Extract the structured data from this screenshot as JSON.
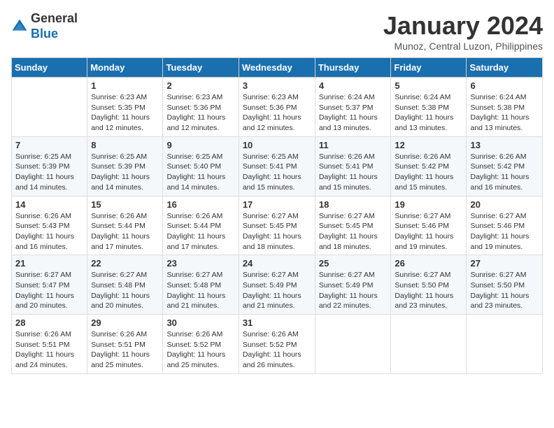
{
  "header": {
    "logo_line1": "General",
    "logo_line2": "Blue",
    "month": "January 2024",
    "location": "Munoz, Central Luzon, Philippines"
  },
  "weekdays": [
    "Sunday",
    "Monday",
    "Tuesday",
    "Wednesday",
    "Thursday",
    "Friday",
    "Saturday"
  ],
  "weeks": [
    [
      {
        "day": "",
        "sunrise": "",
        "sunset": "",
        "daylight": ""
      },
      {
        "day": "1",
        "sunrise": "Sunrise: 6:23 AM",
        "sunset": "Sunset: 5:35 PM",
        "daylight": "Daylight: 11 hours and 12 minutes."
      },
      {
        "day": "2",
        "sunrise": "Sunrise: 6:23 AM",
        "sunset": "Sunset: 5:36 PM",
        "daylight": "Daylight: 11 hours and 12 minutes."
      },
      {
        "day": "3",
        "sunrise": "Sunrise: 6:23 AM",
        "sunset": "Sunset: 5:36 PM",
        "daylight": "Daylight: 11 hours and 12 minutes."
      },
      {
        "day": "4",
        "sunrise": "Sunrise: 6:24 AM",
        "sunset": "Sunset: 5:37 PM",
        "daylight": "Daylight: 11 hours and 13 minutes."
      },
      {
        "day": "5",
        "sunrise": "Sunrise: 6:24 AM",
        "sunset": "Sunset: 5:38 PM",
        "daylight": "Daylight: 11 hours and 13 minutes."
      },
      {
        "day": "6",
        "sunrise": "Sunrise: 6:24 AM",
        "sunset": "Sunset: 5:38 PM",
        "daylight": "Daylight: 11 hours and 13 minutes."
      }
    ],
    [
      {
        "day": "7",
        "sunrise": "Sunrise: 6:25 AM",
        "sunset": "Sunset: 5:39 PM",
        "daylight": "Daylight: 11 hours and 14 minutes."
      },
      {
        "day": "8",
        "sunrise": "Sunrise: 6:25 AM",
        "sunset": "Sunset: 5:39 PM",
        "daylight": "Daylight: 11 hours and 14 minutes."
      },
      {
        "day": "9",
        "sunrise": "Sunrise: 6:25 AM",
        "sunset": "Sunset: 5:40 PM",
        "daylight": "Daylight: 11 hours and 14 minutes."
      },
      {
        "day": "10",
        "sunrise": "Sunrise: 6:25 AM",
        "sunset": "Sunset: 5:41 PM",
        "daylight": "Daylight: 11 hours and 15 minutes."
      },
      {
        "day": "11",
        "sunrise": "Sunrise: 6:26 AM",
        "sunset": "Sunset: 5:41 PM",
        "daylight": "Daylight: 11 hours and 15 minutes."
      },
      {
        "day": "12",
        "sunrise": "Sunrise: 6:26 AM",
        "sunset": "Sunset: 5:42 PM",
        "daylight": "Daylight: 11 hours and 15 minutes."
      },
      {
        "day": "13",
        "sunrise": "Sunrise: 6:26 AM",
        "sunset": "Sunset: 5:42 PM",
        "daylight": "Daylight: 11 hours and 16 minutes."
      }
    ],
    [
      {
        "day": "14",
        "sunrise": "Sunrise: 6:26 AM",
        "sunset": "Sunset: 5:43 PM",
        "daylight": "Daylight: 11 hours and 16 minutes."
      },
      {
        "day": "15",
        "sunrise": "Sunrise: 6:26 AM",
        "sunset": "Sunset: 5:44 PM",
        "daylight": "Daylight: 11 hours and 17 minutes."
      },
      {
        "day": "16",
        "sunrise": "Sunrise: 6:26 AM",
        "sunset": "Sunset: 5:44 PM",
        "daylight": "Daylight: 11 hours and 17 minutes."
      },
      {
        "day": "17",
        "sunrise": "Sunrise: 6:27 AM",
        "sunset": "Sunset: 5:45 PM",
        "daylight": "Daylight: 11 hours and 18 minutes."
      },
      {
        "day": "18",
        "sunrise": "Sunrise: 6:27 AM",
        "sunset": "Sunset: 5:45 PM",
        "daylight": "Daylight: 11 hours and 18 minutes."
      },
      {
        "day": "19",
        "sunrise": "Sunrise: 6:27 AM",
        "sunset": "Sunset: 5:46 PM",
        "daylight": "Daylight: 11 hours and 19 minutes."
      },
      {
        "day": "20",
        "sunrise": "Sunrise: 6:27 AM",
        "sunset": "Sunset: 5:46 PM",
        "daylight": "Daylight: 11 hours and 19 minutes."
      }
    ],
    [
      {
        "day": "21",
        "sunrise": "Sunrise: 6:27 AM",
        "sunset": "Sunset: 5:47 PM",
        "daylight": "Daylight: 11 hours and 20 minutes."
      },
      {
        "day": "22",
        "sunrise": "Sunrise: 6:27 AM",
        "sunset": "Sunset: 5:48 PM",
        "daylight": "Daylight: 11 hours and 20 minutes."
      },
      {
        "day": "23",
        "sunrise": "Sunrise: 6:27 AM",
        "sunset": "Sunset: 5:48 PM",
        "daylight": "Daylight: 11 hours and 21 minutes."
      },
      {
        "day": "24",
        "sunrise": "Sunrise: 6:27 AM",
        "sunset": "Sunset: 5:49 PM",
        "daylight": "Daylight: 11 hours and 21 minutes."
      },
      {
        "day": "25",
        "sunrise": "Sunrise: 6:27 AM",
        "sunset": "Sunset: 5:49 PM",
        "daylight": "Daylight: 11 hours and 22 minutes."
      },
      {
        "day": "26",
        "sunrise": "Sunrise: 6:27 AM",
        "sunset": "Sunset: 5:50 PM",
        "daylight": "Daylight: 11 hours and 23 minutes."
      },
      {
        "day": "27",
        "sunrise": "Sunrise: 6:27 AM",
        "sunset": "Sunset: 5:50 PM",
        "daylight": "Daylight: 11 hours and 23 minutes."
      }
    ],
    [
      {
        "day": "28",
        "sunrise": "Sunrise: 6:26 AM",
        "sunset": "Sunset: 5:51 PM",
        "daylight": "Daylight: 11 hours and 24 minutes."
      },
      {
        "day": "29",
        "sunrise": "Sunrise: 6:26 AM",
        "sunset": "Sunset: 5:51 PM",
        "daylight": "Daylight: 11 hours and 25 minutes."
      },
      {
        "day": "30",
        "sunrise": "Sunrise: 6:26 AM",
        "sunset": "Sunset: 5:52 PM",
        "daylight": "Daylight: 11 hours and 25 minutes."
      },
      {
        "day": "31",
        "sunrise": "Sunrise: 6:26 AM",
        "sunset": "Sunset: 5:52 PM",
        "daylight": "Daylight: 11 hours and 26 minutes."
      },
      {
        "day": "",
        "sunrise": "",
        "sunset": "",
        "daylight": ""
      },
      {
        "day": "",
        "sunrise": "",
        "sunset": "",
        "daylight": ""
      },
      {
        "day": "",
        "sunrise": "",
        "sunset": "",
        "daylight": ""
      }
    ]
  ]
}
